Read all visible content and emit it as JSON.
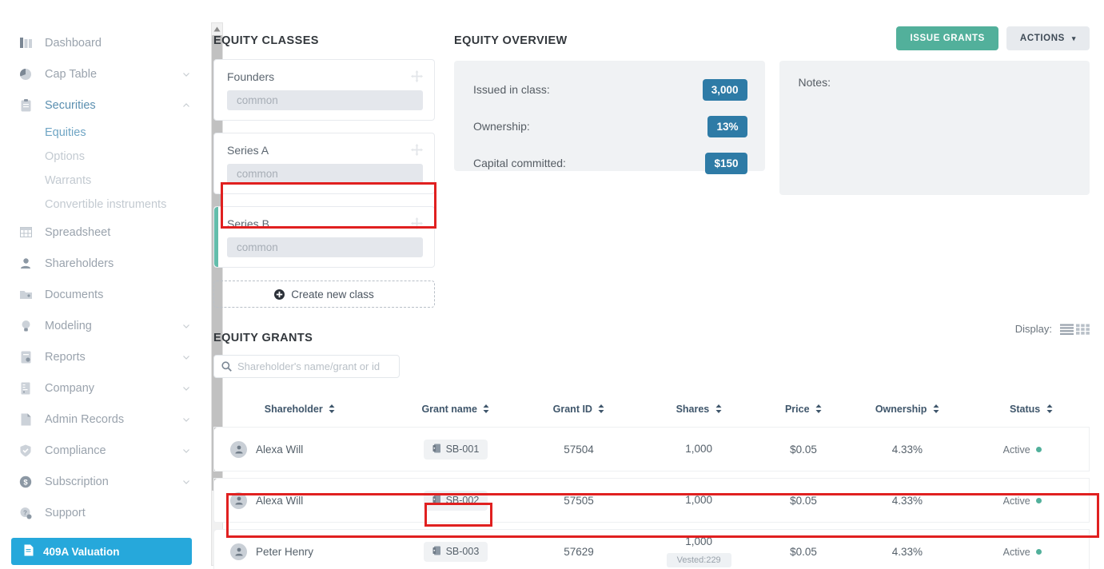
{
  "sidebar": {
    "items": [
      {
        "label": "Dashboard",
        "icon": "dashboard-icon",
        "expandable": false
      },
      {
        "label": "Cap Table",
        "icon": "pie-chart-icon",
        "expandable": true,
        "chevron": "down"
      },
      {
        "label": "Securities",
        "icon": "clipboard-icon",
        "expandable": true,
        "chevron": "up",
        "active": true
      },
      {
        "label": "Spreadsheet",
        "icon": "grid-icon",
        "expandable": false
      },
      {
        "label": "Shareholders",
        "icon": "person-icon",
        "expandable": false
      },
      {
        "label": "Documents",
        "icon": "folder-icon",
        "expandable": false
      },
      {
        "label": "Modeling",
        "icon": "lightbulb-icon",
        "expandable": true,
        "chevron": "down"
      },
      {
        "label": "Reports",
        "icon": "report-icon",
        "expandable": true,
        "chevron": "down"
      },
      {
        "label": "Company",
        "icon": "building-icon",
        "expandable": true,
        "chevron": "down"
      },
      {
        "label": "Admin Records",
        "icon": "admin-icon",
        "expandable": true,
        "chevron": "down"
      },
      {
        "label": "Compliance",
        "icon": "shield-check-icon",
        "expandable": true,
        "chevron": "down"
      },
      {
        "label": "Subscription",
        "icon": "dollar-circle-icon",
        "expandable": true,
        "chevron": "down"
      },
      {
        "label": "Support",
        "icon": "support-icon",
        "expandable": false
      }
    ],
    "securities_subitems": [
      {
        "label": "Equities",
        "current": true
      },
      {
        "label": "Options",
        "current": false
      },
      {
        "label": "Warrants",
        "current": false
      },
      {
        "label": "Convertible instruments",
        "current": false
      }
    ],
    "valuation_button": {
      "label": "409A Valuation",
      "icon": "document-icon",
      "color": "#26a8db"
    }
  },
  "equity_classes": {
    "title": "EQUITY CLASSES",
    "cards": [
      {
        "name": "Founders",
        "type": "common",
        "selected": false
      },
      {
        "name": "Series A",
        "type": "common",
        "selected": false
      },
      {
        "name": "Series B",
        "type": "common",
        "selected": true
      }
    ],
    "create_label": "Create new class",
    "accent_color": "#63bdab"
  },
  "equity_overview": {
    "title": "EQUITY OVERVIEW",
    "stats": [
      {
        "label": "Issued in class:",
        "value": "3,000"
      },
      {
        "label": "Ownership:",
        "value": "13%"
      },
      {
        "label": "Capital committed:",
        "value": "$150"
      }
    ],
    "notes_label": "Notes:",
    "badge_color": "#2e7ba6"
  },
  "top_actions": {
    "issue_grants": "ISSUE GRANTS",
    "actions": "ACTIONS",
    "actions_caret": "▾",
    "primary_color": "#52b09b"
  },
  "equity_grants": {
    "title": "EQUITY GRANTS",
    "search_placeholder": "Shareholder's name/grant or id",
    "search_value": "",
    "display_label": "Display:",
    "columns": [
      {
        "label": "Shareholder",
        "sortable": true
      },
      {
        "label": "Grant name",
        "sortable": true
      },
      {
        "label": "Grant ID",
        "sortable": true
      },
      {
        "label": "Shares",
        "sortable": true
      },
      {
        "label": "Price",
        "sortable": true
      },
      {
        "label": "Ownership",
        "sortable": true
      },
      {
        "label": "Status",
        "sortable": true
      }
    ],
    "rows": [
      {
        "shareholder": "Alexa Will",
        "grant_name": "SB-001",
        "grant_id": "57504",
        "shares": "1,000",
        "vested": null,
        "price": "$0.05",
        "ownership": "4.33%",
        "status": "Active",
        "highlighted": false
      },
      {
        "shareholder": "Alexa Will",
        "grant_name": "SB-002",
        "grant_id": "57505",
        "shares": "1,000",
        "vested": null,
        "price": "$0.05",
        "ownership": "4.33%",
        "status": "Active",
        "highlighted": false
      },
      {
        "shareholder": "Peter Henry",
        "grant_name": "SB-003",
        "grant_id": "57629",
        "shares": "1,000",
        "vested": "Vested:229",
        "price": "$0.05",
        "ownership": "4.33%",
        "status": "Active",
        "highlighted": true
      }
    ],
    "status_color": "#52b09b"
  },
  "annotations": {
    "color": "#e02020",
    "count": 3
  }
}
